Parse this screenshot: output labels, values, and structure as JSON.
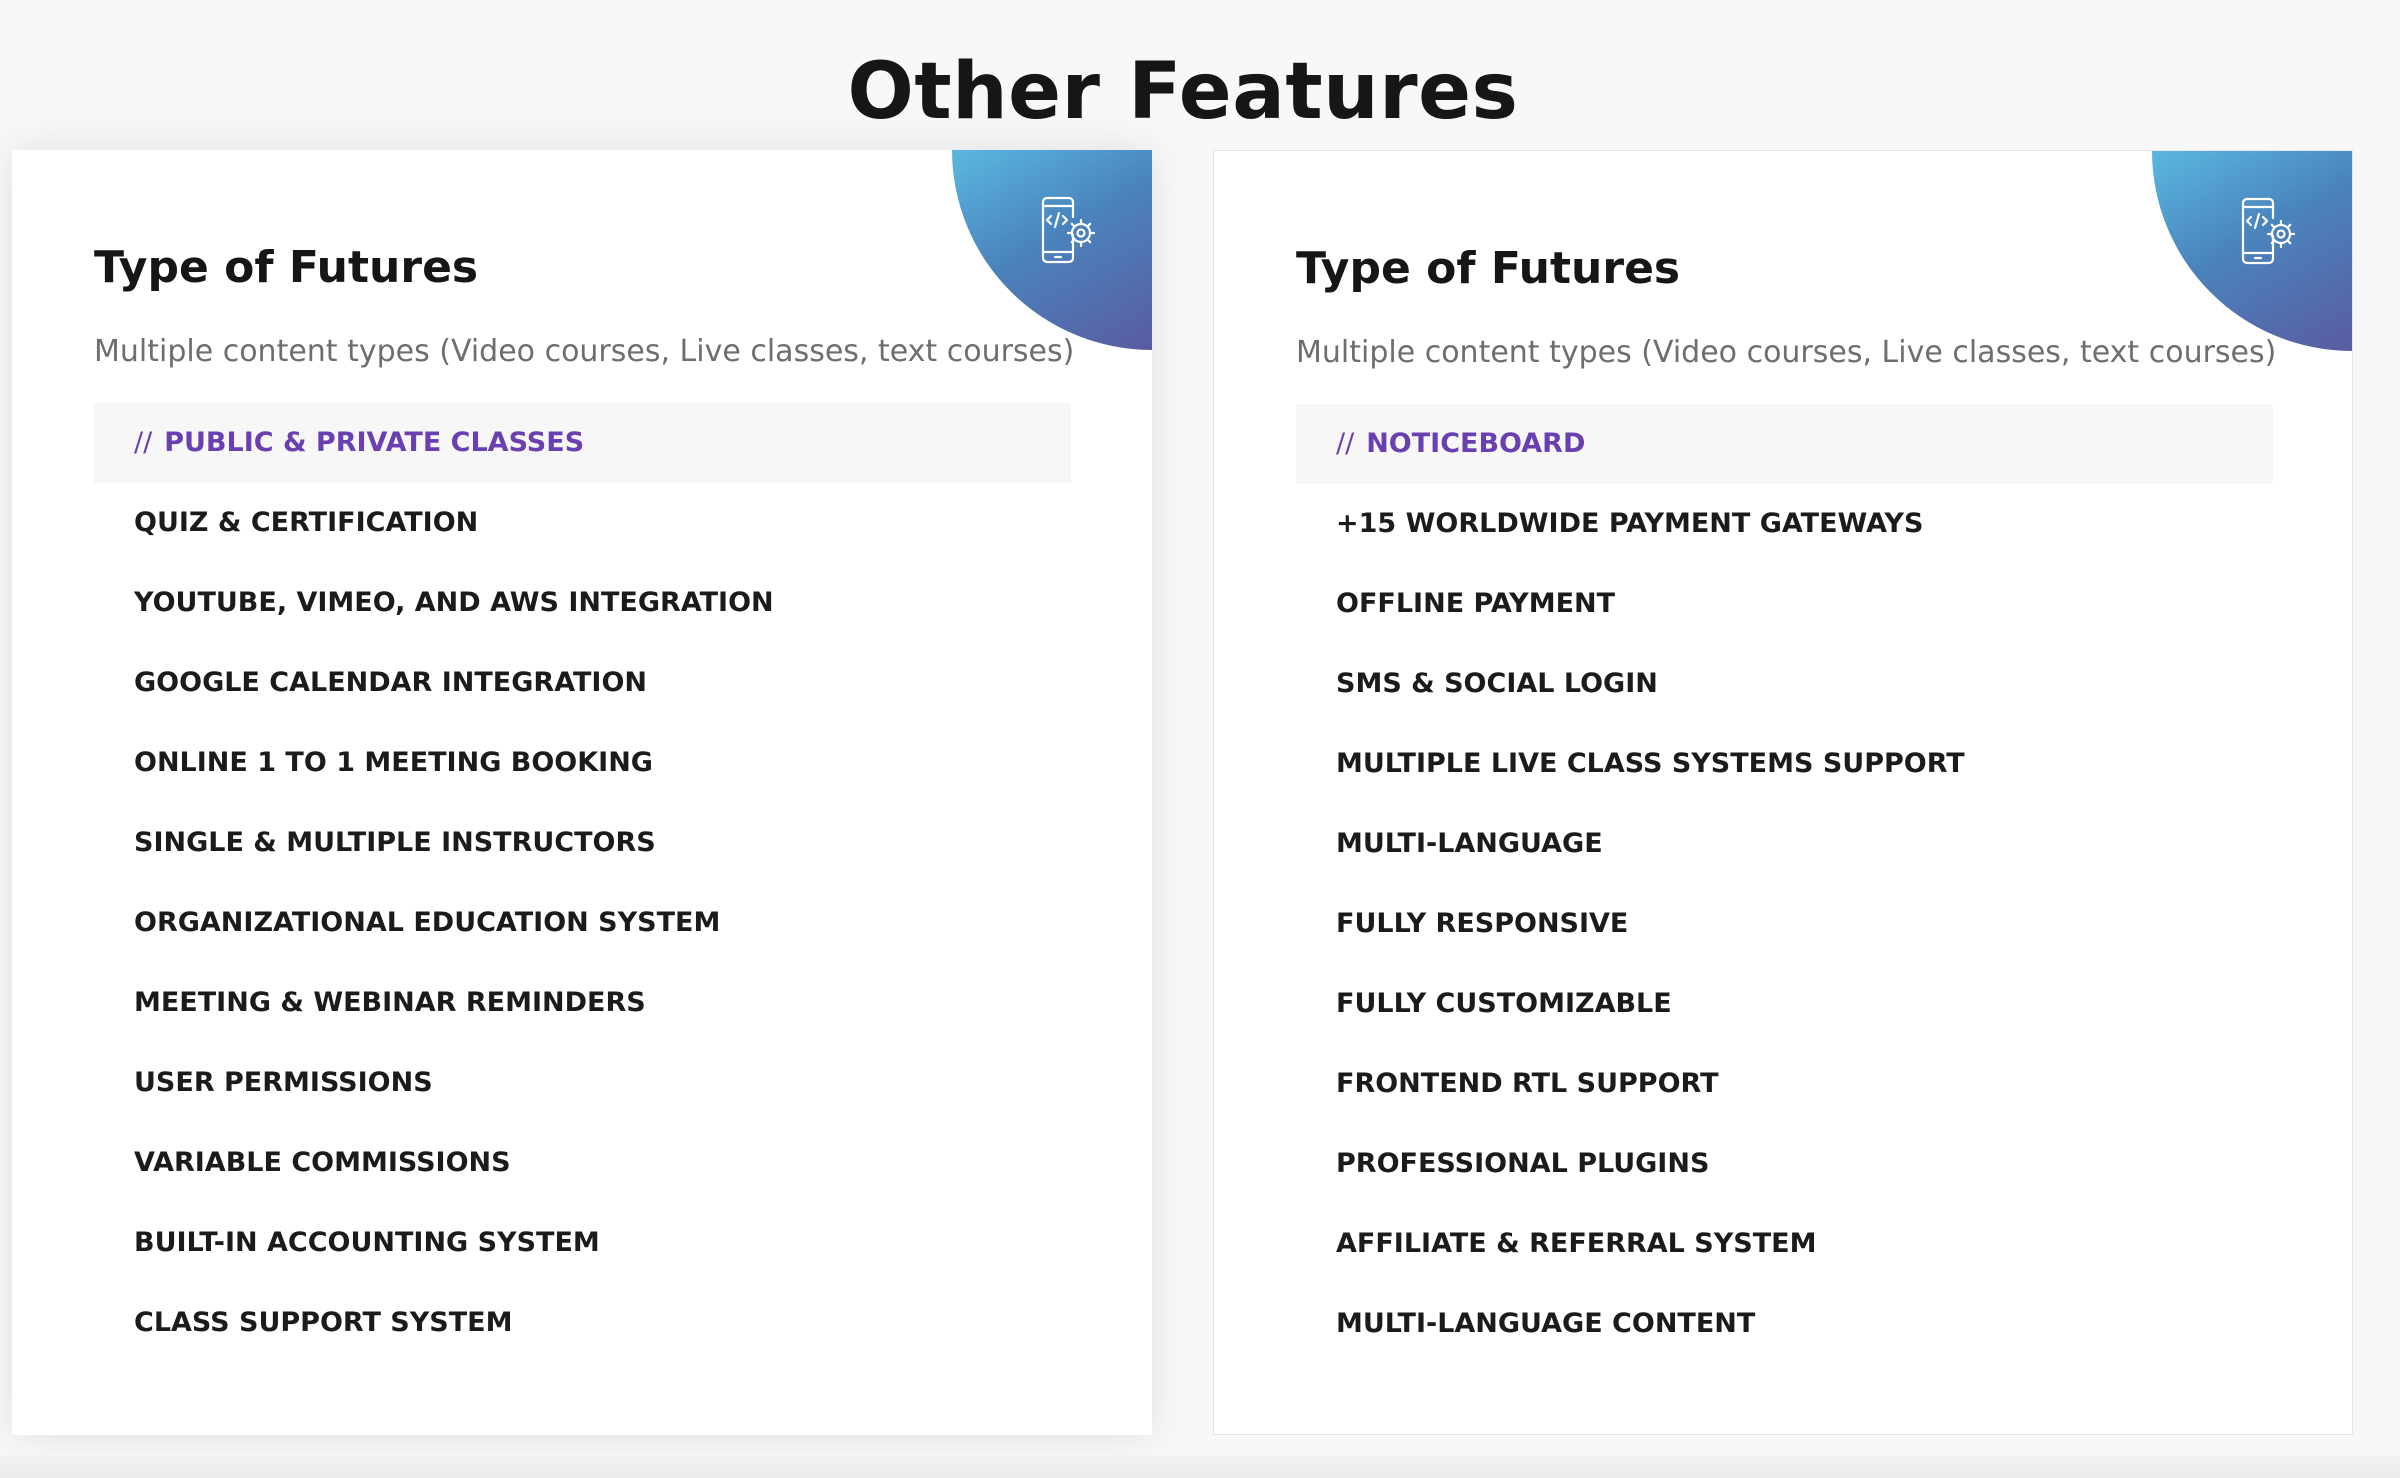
{
  "section": {
    "title": "Other Features"
  },
  "cards": [
    {
      "title": "Type of Futures",
      "subtitle": "Multiple content types (Video courses, Live classes, text courses)",
      "icon": "mobile-code-gear-icon",
      "active_prefix": "//",
      "features": [
        "PUBLIC & PRIVATE CLASSES",
        "QUIZ & CERTIFICATION",
        "YOUTUBE, VIMEO, AND AWS INTEGRATION",
        "GOOGLE CALENDAR INTEGRATION",
        "ONLINE 1 TO 1 MEETING BOOKING",
        "SINGLE & MULTIPLE INSTRUCTORS",
        "ORGANIZATIONAL EDUCATION SYSTEM",
        "MEETING & WEBINAR REMINDERS",
        "USER PERMISSIONS",
        "VARIABLE COMMISSIONS",
        "BUILT-IN ACCOUNTING SYSTEM",
        "CLASS SUPPORT SYSTEM"
      ]
    },
    {
      "title": "Type of Futures",
      "subtitle": "Multiple content types (Video courses, Live classes, text courses)",
      "icon": "mobile-code-gear-icon",
      "active_prefix": "//",
      "features": [
        "NOTICEBOARD",
        "+15 WORLDWIDE PAYMENT GATEWAYS",
        "OFFLINE PAYMENT",
        "SMS & SOCIAL LOGIN",
        "MULTIPLE LIVE CLASS SYSTEMS SUPPORT",
        "MULTI-LANGUAGE",
        "FULLY RESPONSIVE",
        "FULLY CUSTOMIZABLE",
        "FRONTEND RTL SUPPORT",
        "PROFESSIONAL PLUGINS",
        "AFFILIATE & REFERRAL SYSTEM",
        "MULTI-LANGUAGE CONTENT"
      ]
    }
  ],
  "colors": {
    "accent": "#6a3fb0",
    "corner_gradient_start": "#5ab8e0",
    "corner_gradient_end": "#5a5ba0"
  }
}
